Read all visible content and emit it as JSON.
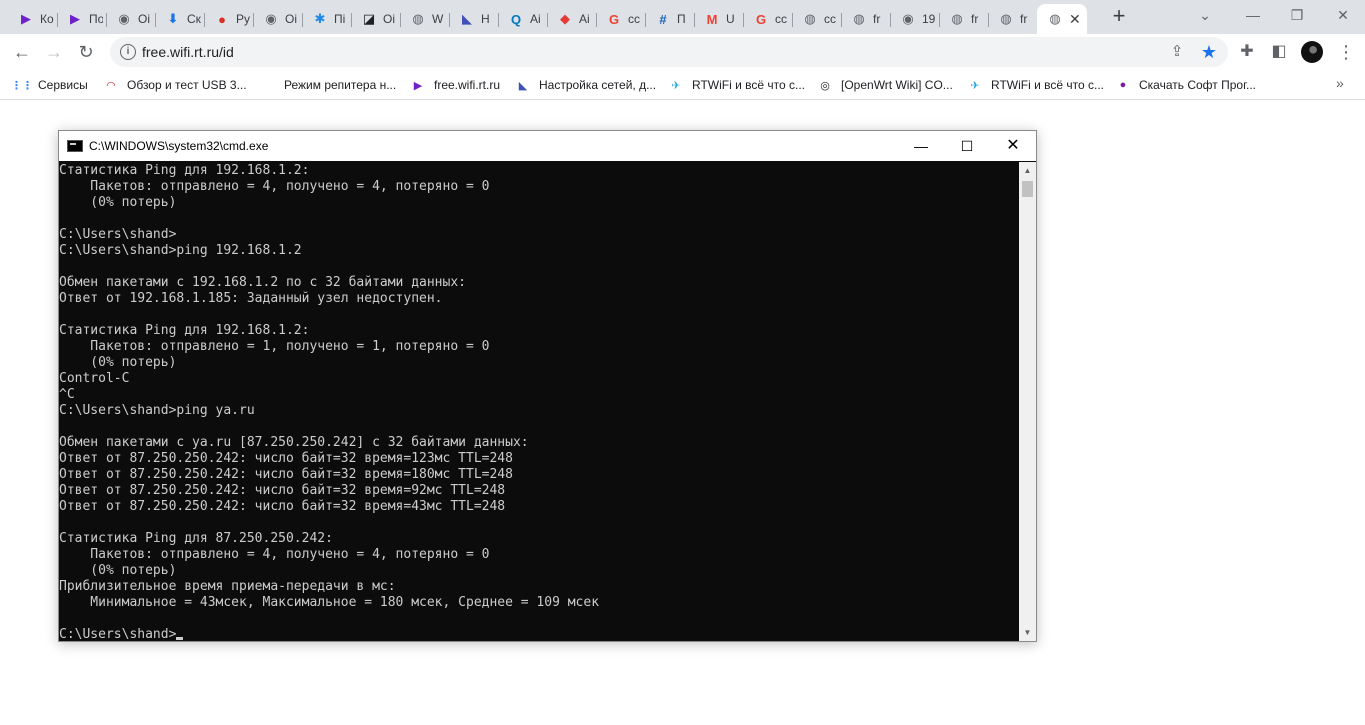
{
  "browser": {
    "tabs": [
      {
        "title": "Ко",
        "icon": "rtwifi-logo-icon",
        "color": "#6f22c8",
        "glyph": "▶"
      },
      {
        "title": "По",
        "icon": "rtwifi-logo-icon",
        "color": "#6f22c8",
        "glyph": "▶"
      },
      {
        "title": "Оі",
        "icon": "wireless-icon",
        "color": "#5f6368",
        "glyph": "◉"
      },
      {
        "title": "Ск",
        "icon": "download-icon",
        "color": "#1a73e8",
        "glyph": "⬇"
      },
      {
        "title": "Ру",
        "icon": "globe-flag-icon",
        "color": "#d93025",
        "glyph": "●"
      },
      {
        "title": "Оі",
        "icon": "wireless-icon",
        "color": "#5f6368",
        "glyph": "◉"
      },
      {
        "title": "Пі",
        "icon": "snowflake-icon",
        "color": "#1e88e5",
        "glyph": "✱"
      },
      {
        "title": "Оі",
        "icon": "openwrt-icon",
        "color": "#202124",
        "glyph": "◪"
      },
      {
        "title": "W",
        "icon": "globe-icon",
        "color": "#5f6368",
        "glyph": "◍"
      },
      {
        "title": "Н",
        "icon": "chart-logo-icon",
        "color": "#3f51b5",
        "glyph": "◣"
      },
      {
        "title": "Аі",
        "icon": "qa-logo-icon",
        "color": "#0277bd",
        "glyph": "Q"
      },
      {
        "title": "Аі",
        "icon": "shield-logo-icon",
        "color": "#e53935",
        "glyph": "◆"
      },
      {
        "title": "сс",
        "icon": "google-icon",
        "color": "#ffffff",
        "glyph": "G"
      },
      {
        "title": "П",
        "icon": "settings-grid-icon",
        "color": "#1565c0",
        "glyph": "#"
      },
      {
        "title": "U",
        "icon": "gmail-icon",
        "color": "#ffffff",
        "glyph": "M"
      },
      {
        "title": "сс",
        "icon": "google-icon",
        "color": "#ffffff",
        "glyph": "G"
      },
      {
        "title": "сс",
        "icon": "globe-icon",
        "color": "#5f6368",
        "glyph": "◍"
      },
      {
        "title": "fr",
        "icon": "globe-icon",
        "color": "#5f6368",
        "glyph": "◍"
      },
      {
        "title": "19",
        "icon": "wireless-icon",
        "color": "#5f6368",
        "glyph": "◉"
      },
      {
        "title": "fr",
        "icon": "globe-icon",
        "color": "#5f6368",
        "glyph": "◍"
      },
      {
        "title": "fr",
        "icon": "globe-icon",
        "color": "#5f6368",
        "glyph": "◍"
      },
      {
        "title": "",
        "icon": "globe-icon",
        "color": "#5f6368",
        "glyph": "◍",
        "active": true
      }
    ],
    "address": "free.wifi.rt.ru/id",
    "bookmarks": [
      {
        "label": "Сервисы",
        "icon": "apps-grid-icon",
        "glyph": "⋮⋮",
        "color": "#4285f4"
      },
      {
        "label": "Обзор и тест USB 3...",
        "icon": "bookmark-logo-icon",
        "glyph": "◠",
        "color": "#d32f2f"
      },
      {
        "label": "Режим репитера н...",
        "icon": "",
        "glyph": "",
        "color": "#ffffff"
      },
      {
        "label": "free.wifi.rt.ru",
        "icon": "rtwifi-logo-icon",
        "glyph": "▶",
        "color": "#6f22c8"
      },
      {
        "label": "Настройка сетей, д...",
        "icon": "chart-logo-icon",
        "glyph": "◣",
        "color": "#3f51b5"
      },
      {
        "label": "RTWiFi и всё что с...",
        "icon": "rtwifi-bird-icon",
        "glyph": "✈",
        "color": "#26a7de"
      },
      {
        "label": "[OpenWrt Wiki] CO...",
        "icon": "openwrt-icon",
        "glyph": "◎",
        "color": "#202124"
      },
      {
        "label": "RTWiFi и всё что с...",
        "icon": "rtwifi-bird-icon",
        "glyph": "✈",
        "color": "#26a7de"
      },
      {
        "label": "Скачать Софт Прог...",
        "icon": "software-logo-icon",
        "glyph": "●",
        "color": "#7b1fa2"
      }
    ]
  },
  "cmd": {
    "title": "C:\\WINDOWS\\system32\\cmd.exe",
    "lines": [
      "Статистика Ping для 192.168.1.2:",
      "    Пакетов: отправлено = 4, получено = 4, потеряно = 0",
      "    (0% потерь)",
      "",
      "C:\\Users\\shand>",
      "C:\\Users\\shand>ping 192.168.1.2",
      "",
      "Обмен пакетами с 192.168.1.2 по с 32 байтами данных:",
      "Ответ от 192.168.1.185: Заданный узел недоступен.",
      "",
      "Статистика Ping для 192.168.1.2:",
      "    Пакетов: отправлено = 1, получено = 1, потеряно = 0",
      "    (0% потерь)",
      "Control-C",
      "^C",
      "C:\\Users\\shand>ping ya.ru",
      "",
      "Обмен пакетами с ya.ru [87.250.250.242] с 32 байтами данных:",
      "Ответ от 87.250.250.242: число байт=32 время=123мс TTL=248",
      "Ответ от 87.250.250.242: число байт=32 время=180мс TTL=248",
      "Ответ от 87.250.250.242: число байт=32 время=92мс TTL=248",
      "Ответ от 87.250.250.242: число байт=32 время=43мс TTL=248",
      "",
      "Статистика Ping для 87.250.250.242:",
      "    Пакетов: отправлено = 4, получено = 4, потеряно = 0",
      "    (0% потерь)",
      "Приблизительное время приема-передачи в мс:",
      "    Минимальное = 43мсек, Максимальное = 180 мсек, Среднее = 109 мсек",
      ""
    ],
    "prompt": "C:\\Users\\shand>"
  }
}
